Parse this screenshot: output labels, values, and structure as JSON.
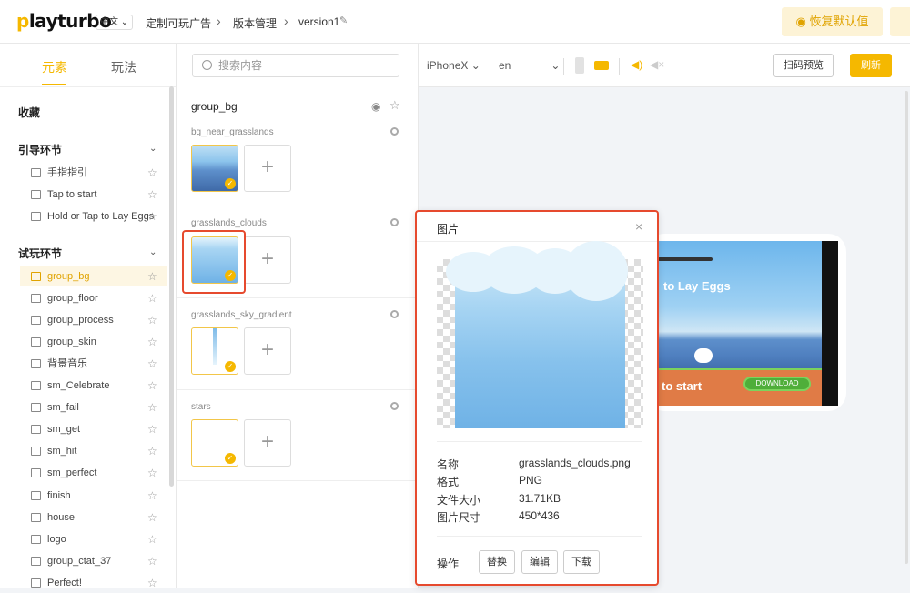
{
  "topbar": {
    "logo": "playturbo",
    "lang": "中文",
    "crumbs": [
      "定制可玩广告",
      "版本管理",
      "version1"
    ],
    "restore_label": "恢复默认值"
  },
  "left": {
    "tabs": [
      "元素",
      "玩法"
    ],
    "favorites": "收藏",
    "sections": [
      {
        "title": "引导环节",
        "items": [
          "手指指引",
          "Tap to start",
          "Hold or Tap to Lay Eggs"
        ]
      },
      {
        "title": "试玩环节",
        "items": [
          "group_bg",
          "group_floor",
          "group_process",
          "group_skin",
          "背景音乐",
          "sm_Celebrate",
          "sm_fail",
          "sm_get",
          "sm_hit",
          "sm_perfect",
          "finish",
          "house",
          "logo",
          "group_ctat_37",
          "Perfect!"
        ]
      }
    ]
  },
  "mid": {
    "search_placeholder": "搜索内容",
    "group_title": "group_bg",
    "slots": [
      "bg_near_grasslands",
      "grasslands_clouds",
      "grasslands_sky_gradient",
      "stars"
    ]
  },
  "right": {
    "device": "iPhoneX",
    "lang": "en",
    "qr_label": "扫码预览",
    "refresh_label": "刷新",
    "preview_title": "to Lay Eggs",
    "preview_start": "to start",
    "preview_download": "DOWNLOAD"
  },
  "popup": {
    "title": "图片",
    "fields": [
      {
        "label": "名称",
        "value": "grasslands_clouds.png"
      },
      {
        "label": "格式",
        "value": "PNG"
      },
      {
        "label": "文件大小",
        "value": "31.71KB"
      },
      {
        "label": "图片尺寸",
        "value": "450*436"
      }
    ],
    "actions_label": "操作",
    "buttons": [
      "替换",
      "编辑",
      "下载"
    ]
  },
  "colors": {
    "accent": "#f5b800",
    "highlight": "#e64a2e"
  }
}
